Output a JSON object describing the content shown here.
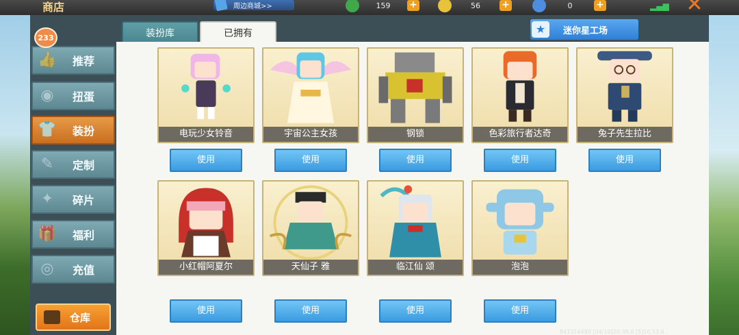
{
  "topbar": {
    "title": "商店",
    "nearby_button": "周边商城>>",
    "currencies": [
      {
        "icon": "green-gem-icon",
        "value": "159",
        "color": "#3fa84a"
      },
      {
        "icon": "gold-coin-icon",
        "value": "56",
        "color": "#e8c23a"
      },
      {
        "icon": "blue-star-coin-icon",
        "value": "0",
        "color": "#4f8de0"
      }
    ],
    "plus_label": "+"
  },
  "sidebar": {
    "badge": "233",
    "items": [
      {
        "label": "推荐",
        "icon": "thumbs-up-icon"
      },
      {
        "label": "扭蛋",
        "icon": "capsule-icon"
      },
      {
        "label": "装扮",
        "icon": "shirt-icon",
        "active": true
      },
      {
        "label": "定制",
        "icon": "pencil-icon"
      },
      {
        "label": "碎片",
        "icon": "puzzle-icon"
      },
      {
        "label": "福利",
        "icon": "gift-icon"
      },
      {
        "label": "充值",
        "icon": "coin-stack-icon"
      }
    ],
    "warehouse_label": "仓库"
  },
  "tabs": [
    {
      "label": "装扮库"
    },
    {
      "label": "已拥有"
    }
  ],
  "workshop_button": "迷你星工场",
  "skins": [
    {
      "name": "电玩少女铃音",
      "accent": "#e7a0d8"
    },
    {
      "name": "宇宙公主女孩",
      "accent": "#5fc7e6"
    },
    {
      "name": "钢锁",
      "accent": "#d8c230"
    },
    {
      "name": "色彩旅行者达奇",
      "accent": "#ea6a2a"
    },
    {
      "name": "兔子先生拉比",
      "accent": "#3c5a84"
    },
    {
      "name": "小红帽阿夏尔",
      "accent": "#c8302a"
    },
    {
      "name": "天仙子 雅",
      "accent": "#3f9a8c"
    },
    {
      "name": "临江仙 颂",
      "accent": "#2f8ea8"
    },
    {
      "name": "泡泡",
      "accent": "#8fc8e6"
    }
  ],
  "use_label": "使用",
  "footer": "841316490    [04/10]20:38.0   [5]10.53.6"
}
